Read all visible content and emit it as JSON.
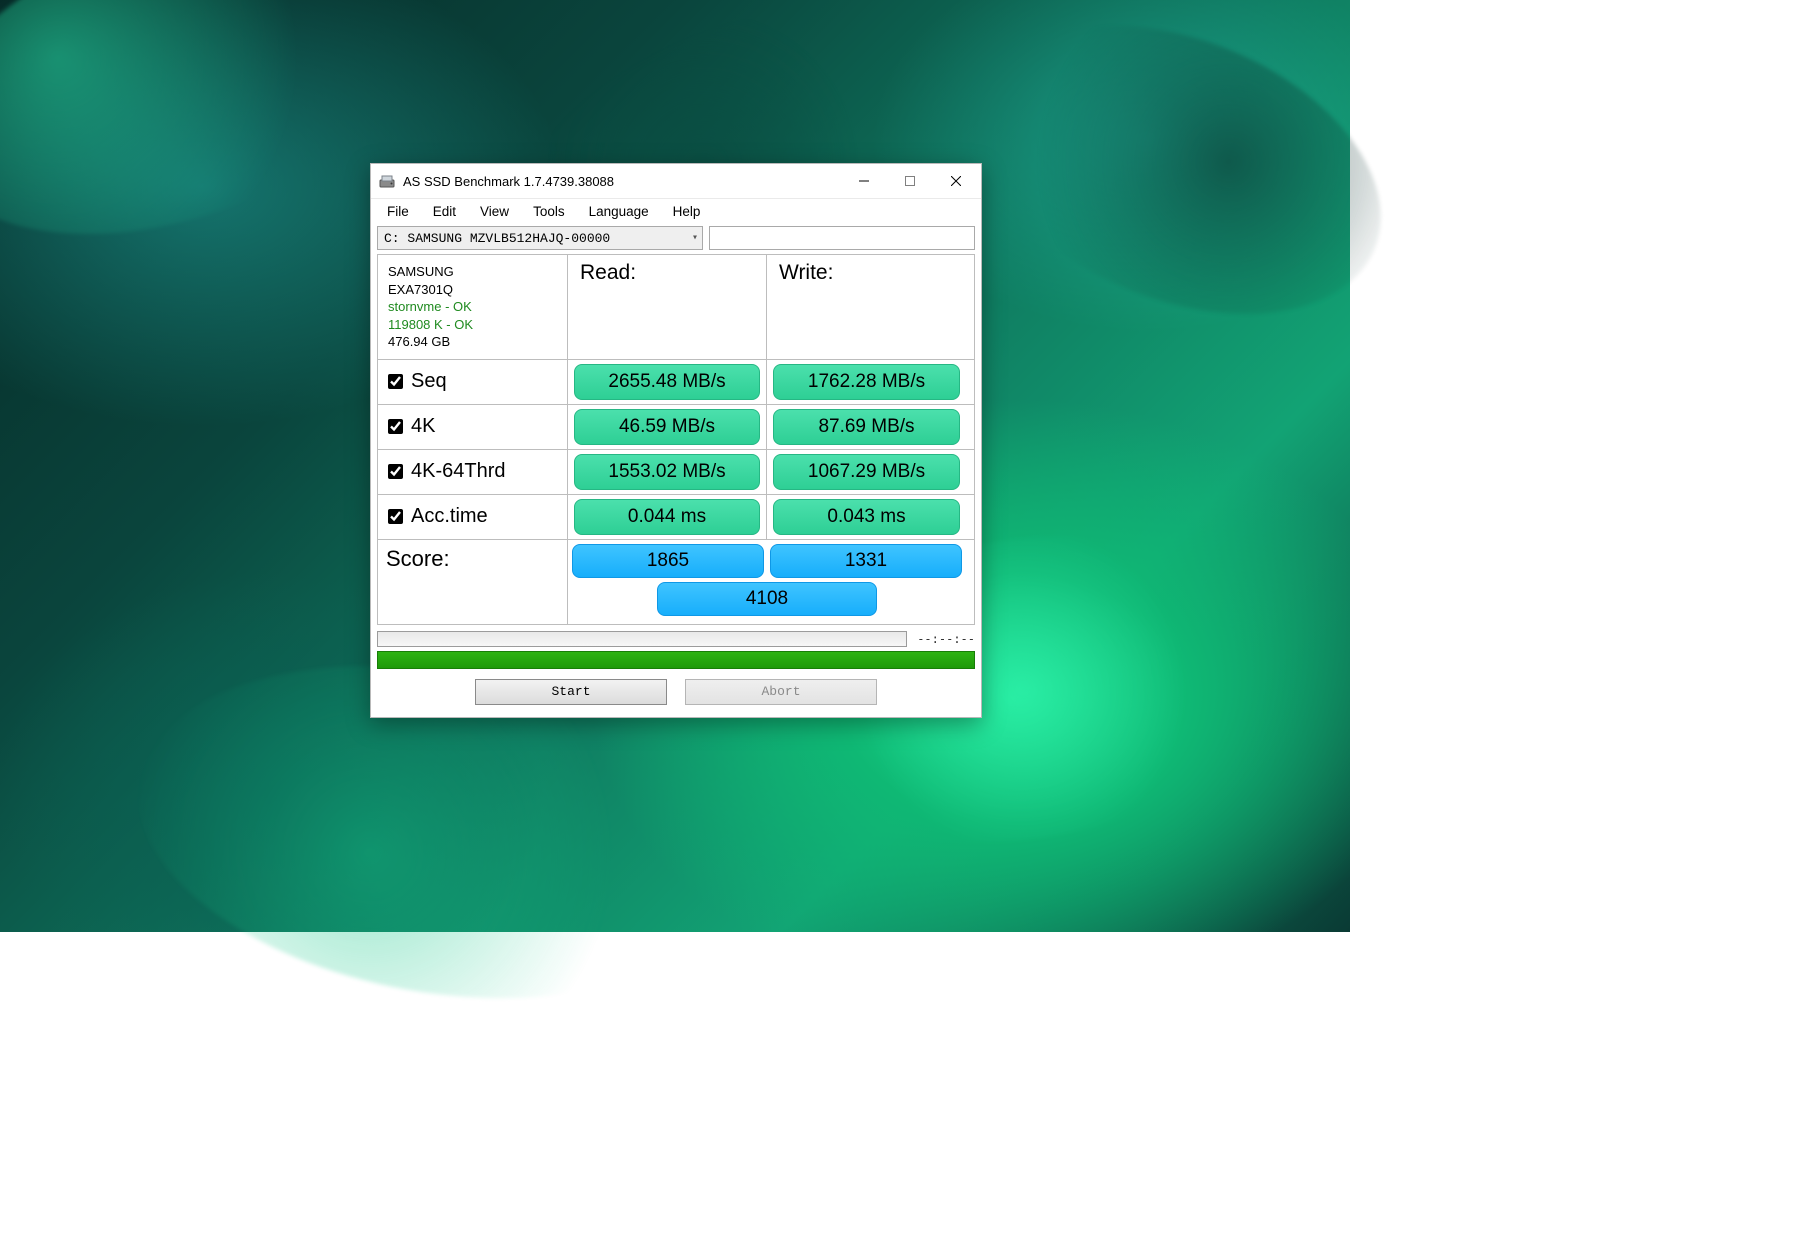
{
  "window": {
    "title": "AS SSD Benchmark 1.7.4739.38088"
  },
  "menu": {
    "file": "File",
    "edit": "Edit",
    "view": "View",
    "tools": "Tools",
    "language": "Language",
    "help": "Help"
  },
  "driveSelector": {
    "selected": "C: SAMSUNG MZVLB512HAJQ-00000"
  },
  "info": {
    "vendor": "SAMSUNG",
    "firmware": "EXA7301Q",
    "driver": "stornvme - OK",
    "alignment": "119808 K - OK",
    "capacity": "476.94 GB"
  },
  "headers": {
    "read": "Read:",
    "write": "Write:",
    "score": "Score:"
  },
  "rows": {
    "seq": {
      "label": "Seq",
      "read": "2655.48 MB/s",
      "write": "1762.28 MB/s"
    },
    "k4": {
      "label": "4K",
      "read": "46.59 MB/s",
      "write": "87.69 MB/s"
    },
    "k4t": {
      "label": "4K-64Thrd",
      "read": "1553.02 MB/s",
      "write": "1067.29 MB/s"
    },
    "acc": {
      "label": "Acc.time",
      "read": "0.044 ms",
      "write": "0.043 ms"
    }
  },
  "score": {
    "read": "1865",
    "write": "1331",
    "total": "4108"
  },
  "status": {
    "time": "--:--:--"
  },
  "buttons": {
    "start": "Start",
    "abort": "Abort"
  }
}
